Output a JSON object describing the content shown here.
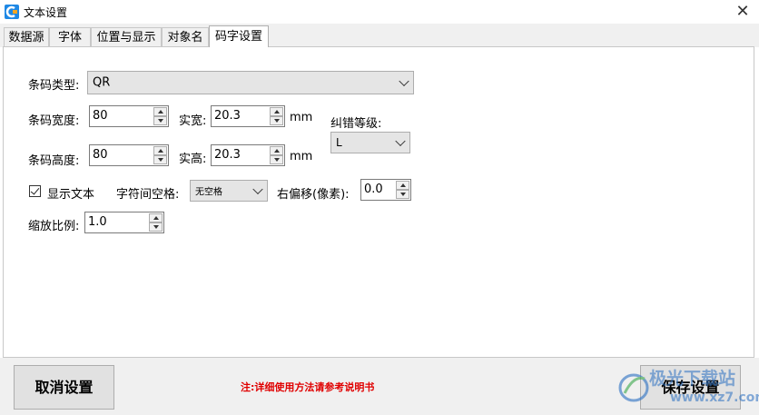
{
  "window": {
    "title": "文本设置",
    "close_glyph": "✕"
  },
  "tabs": [
    {
      "label": "数据源"
    },
    {
      "label": "字体"
    },
    {
      "label": "位置与显示"
    },
    {
      "label": "对象名"
    },
    {
      "label": "码字设置",
      "active": true
    }
  ],
  "form": {
    "barcode_type": {
      "label": "条码类型:",
      "value": "QR"
    },
    "width": {
      "label": "条码宽度:",
      "value": "80",
      "actual_label": "实宽:",
      "actual_value": "20.3",
      "unit": "mm"
    },
    "height": {
      "label": "条码高度:",
      "value": "80",
      "actual_label": "实高:",
      "actual_value": "20.3",
      "unit": "mm"
    },
    "error_level": {
      "label": "纠错等级:",
      "value": "L"
    },
    "show_text": {
      "label": "显示文本",
      "checked": true
    },
    "char_spacing": {
      "label": "字符间空格:",
      "value": "无空格"
    },
    "right_offset": {
      "label": "右偏移(像素):",
      "value": "0.0"
    },
    "scale": {
      "label": "缩放比例:",
      "value": "1.0"
    }
  },
  "footer": {
    "cancel_label": "取消设置",
    "save_label": "保存设置",
    "note": "注:详细使用方法请参考说明书"
  },
  "watermark": {
    "name": "极光下载站",
    "url": "www.xz7.com"
  },
  "colors": {
    "note": "#e00000",
    "app_icon": "#1e88e5",
    "watermark": "#2a6fc2"
  }
}
